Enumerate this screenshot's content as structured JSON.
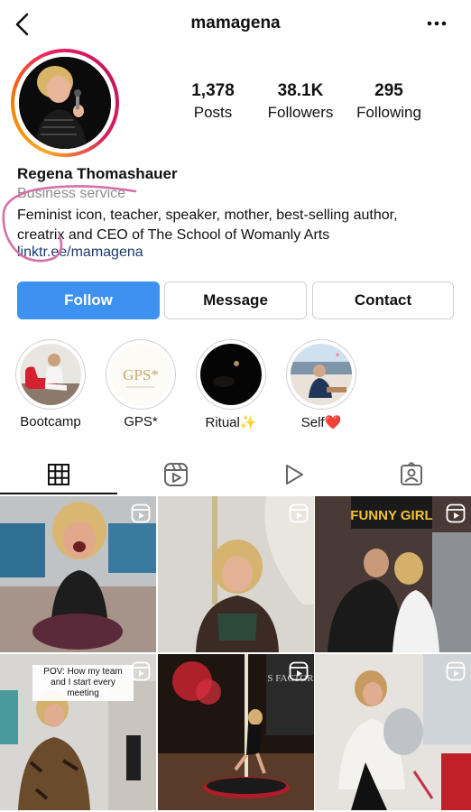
{
  "header": {
    "username": "mamagena",
    "back_icon": "chevron-left-icon",
    "more_icon": "ellipsis-icon"
  },
  "profile": {
    "display_name": "Regena Thomashauer",
    "category": "Business service",
    "bio_line1": "Feminist icon, teacher, speaker, mother, best-selling author,",
    "bio_line2": "creatrix and CEO of The School of Womanly Arts",
    "link": "linktr.ee/mamagena"
  },
  "stats": {
    "posts_count": "1,378",
    "posts_label": "Posts",
    "followers_count": "38.1K",
    "followers_label": "Followers",
    "following_count": "295",
    "following_label": "Following"
  },
  "actions": {
    "follow": "Follow",
    "message": "Message",
    "contact": "Contact"
  },
  "highlights": [
    {
      "label": "Bootcamp"
    },
    {
      "label": "GPS*",
      "cover_text": "GPS*"
    },
    {
      "label": "Ritual✨"
    },
    {
      "label": "Self❤️"
    }
  ],
  "tabs": [
    "grid-icon",
    "reels-icon",
    "play-icon",
    "tagged-icon"
  ],
  "posts": [
    {
      "type": "reel"
    },
    {
      "type": "reel"
    },
    {
      "type": "reel",
      "sign_text": "FUNNY GIRL"
    },
    {
      "type": "reel",
      "caption": "POV: How my team and I start every meeting"
    },
    {
      "type": "reel",
      "sign_text": "S FACTOR"
    },
    {
      "type": "reel"
    }
  ],
  "colors": {
    "follow_button": "#3d91f1",
    "link": "#1c3b6d",
    "category": "#8e8e8e",
    "scribble": "#d76fa8"
  }
}
